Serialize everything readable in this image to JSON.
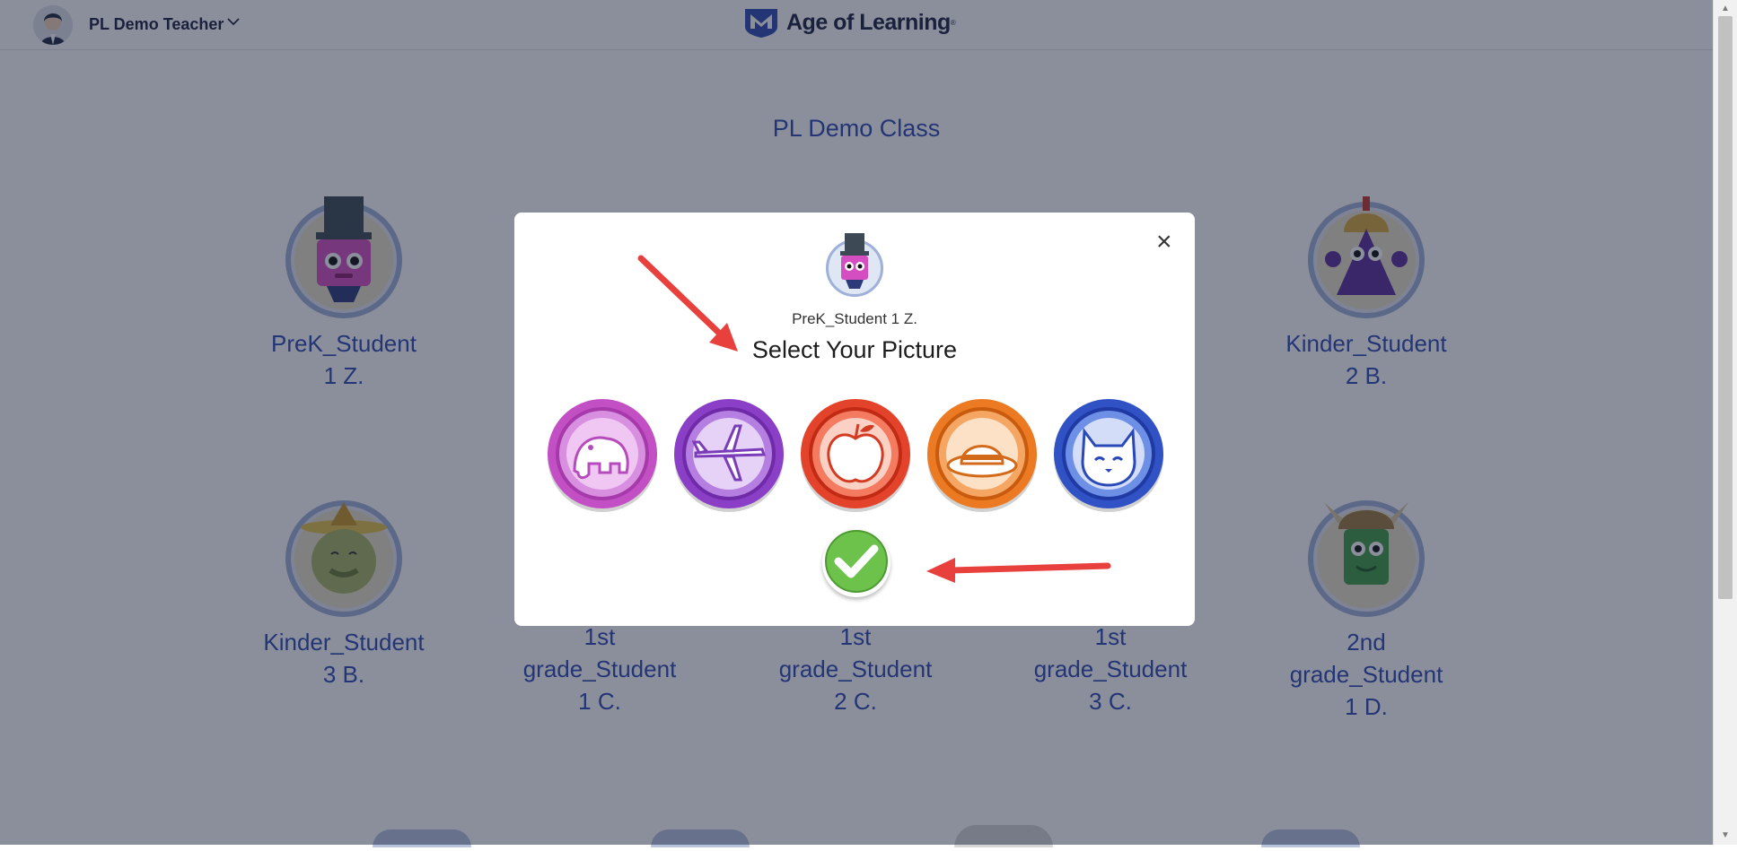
{
  "header": {
    "teacher_name": "PL Demo Teacher",
    "logo_text": "Age of Learning",
    "logo_mark": "®"
  },
  "class_title": "PL Demo Class",
  "students": [
    {
      "line1": "PreK_Student",
      "line2": "1 Z.",
      "line3": ""
    },
    {
      "line1": "Kinder_Student",
      "line2": "2 B.",
      "line3": ""
    },
    {
      "line1": "Kinder_Student",
      "line2": "3 B.",
      "line3": ""
    },
    {
      "line1": "1st",
      "line2": "grade_Student",
      "line3": "1 C."
    },
    {
      "line1": "1st",
      "line2": "grade_Student",
      "line3": "2 C."
    },
    {
      "line1": "1st",
      "line2": "grade_Student",
      "line3": "3 C."
    },
    {
      "line1": "2nd",
      "line2": "grade_Student",
      "line3": "1 D."
    }
  ],
  "modal": {
    "student_name": "PreK_Student 1 Z.",
    "title": "Select Your Picture",
    "close_symbol": "×",
    "pictures": [
      {
        "name": "elephant-icon",
        "color": "#c34fc4"
      },
      {
        "name": "airplane-icon",
        "color": "#8b3fc6"
      },
      {
        "name": "apple-icon",
        "color": "#e4432b"
      },
      {
        "name": "hat-icon",
        "color": "#eb7a23"
      },
      {
        "name": "cat-icon",
        "color": "#3052c4"
      }
    ]
  },
  "colors": {
    "link_blue": "#2f4bb3",
    "annotation_arrow": "#e8413d",
    "confirm_green": "#6cc24a"
  }
}
